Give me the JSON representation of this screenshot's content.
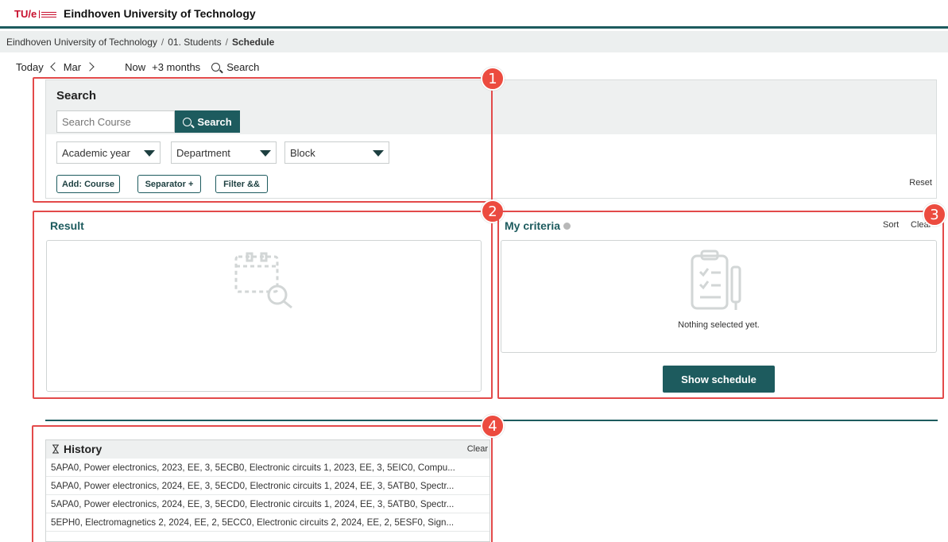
{
  "header": {
    "logo_text": "TU/e",
    "brand": "Eindhoven University of Technology"
  },
  "breadcrumb": {
    "items": [
      "Eindhoven University of Technology",
      "01. Students",
      "Schedule"
    ],
    "separator": "/"
  },
  "nav": {
    "today": "Today",
    "month": "Mar",
    "now": "Now",
    "plus3": "+3 months",
    "search": "Search"
  },
  "search_panel": {
    "title": "Search",
    "input_placeholder": "Search Course",
    "search_button": "Search",
    "dropdowns": [
      "Academic year",
      "Department",
      "Block"
    ],
    "chips": [
      "Add: Course",
      "Separator +",
      "Filter &&"
    ],
    "reset": "Reset"
  },
  "result": {
    "title": "Result"
  },
  "criteria": {
    "title": "My criteria",
    "sort": "Sort",
    "clear": "Clear",
    "empty_text": "Nothing selected yet.",
    "show_button": "Show schedule"
  },
  "history": {
    "title": "History",
    "clear": "Clear",
    "rows": [
      "5APA0, Power electronics, 2023, EE, 3, 5ECB0, Electronic circuits 1, 2023, EE, 3, 5EIC0, Compu...",
      "5APA0, Power electronics, 2024, EE, 3, 5ECD0, Electronic circuits 1, 2024, EE, 3, 5ATB0, Spectr...",
      "5APA0, Power electronics, 2024, EE, 3, 5ECD0, Electronic circuits 1, 2024, EE, 3, 5ATB0, Spectr...",
      "5EPH0, Electromagnetics 2, 2024, EE, 2, 5ECC0, Electronic circuits 2, 2024, EE, 2, 5ESF0, Sign..."
    ]
  },
  "annotations": [
    "1",
    "2",
    "3",
    "4"
  ],
  "colors": {
    "accent": "#1d5b5e",
    "annotation": "#e34a4a",
    "brand_red": "#c8102e"
  }
}
